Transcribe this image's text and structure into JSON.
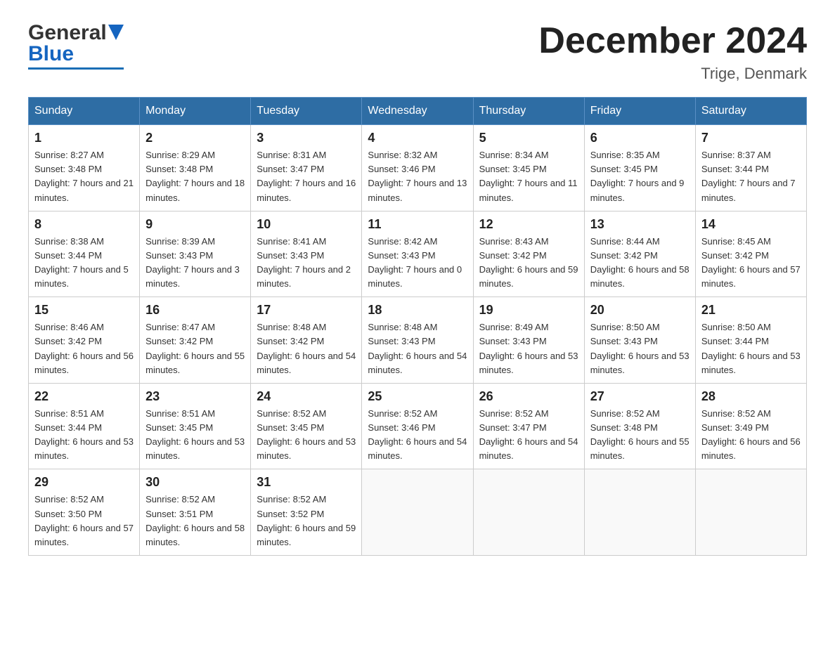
{
  "header": {
    "logo_general": "General",
    "logo_blue": "Blue",
    "month_title": "December 2024",
    "subtitle": "Trige, Denmark"
  },
  "days_of_week": [
    "Sunday",
    "Monday",
    "Tuesday",
    "Wednesday",
    "Thursday",
    "Friday",
    "Saturday"
  ],
  "weeks": [
    [
      {
        "day": "1",
        "sunrise": "8:27 AM",
        "sunset": "3:48 PM",
        "daylight": "7 hours and 21 minutes."
      },
      {
        "day": "2",
        "sunrise": "8:29 AM",
        "sunset": "3:48 PM",
        "daylight": "7 hours and 18 minutes."
      },
      {
        "day": "3",
        "sunrise": "8:31 AM",
        "sunset": "3:47 PM",
        "daylight": "7 hours and 16 minutes."
      },
      {
        "day": "4",
        "sunrise": "8:32 AM",
        "sunset": "3:46 PM",
        "daylight": "7 hours and 13 minutes."
      },
      {
        "day": "5",
        "sunrise": "8:34 AM",
        "sunset": "3:45 PM",
        "daylight": "7 hours and 11 minutes."
      },
      {
        "day": "6",
        "sunrise": "8:35 AM",
        "sunset": "3:45 PM",
        "daylight": "7 hours and 9 minutes."
      },
      {
        "day": "7",
        "sunrise": "8:37 AM",
        "sunset": "3:44 PM",
        "daylight": "7 hours and 7 minutes."
      }
    ],
    [
      {
        "day": "8",
        "sunrise": "8:38 AM",
        "sunset": "3:44 PM",
        "daylight": "7 hours and 5 minutes."
      },
      {
        "day": "9",
        "sunrise": "8:39 AM",
        "sunset": "3:43 PM",
        "daylight": "7 hours and 3 minutes."
      },
      {
        "day": "10",
        "sunrise": "8:41 AM",
        "sunset": "3:43 PM",
        "daylight": "7 hours and 2 minutes."
      },
      {
        "day": "11",
        "sunrise": "8:42 AM",
        "sunset": "3:43 PM",
        "daylight": "7 hours and 0 minutes."
      },
      {
        "day": "12",
        "sunrise": "8:43 AM",
        "sunset": "3:42 PM",
        "daylight": "6 hours and 59 minutes."
      },
      {
        "day": "13",
        "sunrise": "8:44 AM",
        "sunset": "3:42 PM",
        "daylight": "6 hours and 58 minutes."
      },
      {
        "day": "14",
        "sunrise": "8:45 AM",
        "sunset": "3:42 PM",
        "daylight": "6 hours and 57 minutes."
      }
    ],
    [
      {
        "day": "15",
        "sunrise": "8:46 AM",
        "sunset": "3:42 PM",
        "daylight": "6 hours and 56 minutes."
      },
      {
        "day": "16",
        "sunrise": "8:47 AM",
        "sunset": "3:42 PM",
        "daylight": "6 hours and 55 minutes."
      },
      {
        "day": "17",
        "sunrise": "8:48 AM",
        "sunset": "3:42 PM",
        "daylight": "6 hours and 54 minutes."
      },
      {
        "day": "18",
        "sunrise": "8:48 AM",
        "sunset": "3:43 PM",
        "daylight": "6 hours and 54 minutes."
      },
      {
        "day": "19",
        "sunrise": "8:49 AM",
        "sunset": "3:43 PM",
        "daylight": "6 hours and 53 minutes."
      },
      {
        "day": "20",
        "sunrise": "8:50 AM",
        "sunset": "3:43 PM",
        "daylight": "6 hours and 53 minutes."
      },
      {
        "day": "21",
        "sunrise": "8:50 AM",
        "sunset": "3:44 PM",
        "daylight": "6 hours and 53 minutes."
      }
    ],
    [
      {
        "day": "22",
        "sunrise": "8:51 AM",
        "sunset": "3:44 PM",
        "daylight": "6 hours and 53 minutes."
      },
      {
        "day": "23",
        "sunrise": "8:51 AM",
        "sunset": "3:45 PM",
        "daylight": "6 hours and 53 minutes."
      },
      {
        "day": "24",
        "sunrise": "8:52 AM",
        "sunset": "3:45 PM",
        "daylight": "6 hours and 53 minutes."
      },
      {
        "day": "25",
        "sunrise": "8:52 AM",
        "sunset": "3:46 PM",
        "daylight": "6 hours and 54 minutes."
      },
      {
        "day": "26",
        "sunrise": "8:52 AM",
        "sunset": "3:47 PM",
        "daylight": "6 hours and 54 minutes."
      },
      {
        "day": "27",
        "sunrise": "8:52 AM",
        "sunset": "3:48 PM",
        "daylight": "6 hours and 55 minutes."
      },
      {
        "day": "28",
        "sunrise": "8:52 AM",
        "sunset": "3:49 PM",
        "daylight": "6 hours and 56 minutes."
      }
    ],
    [
      {
        "day": "29",
        "sunrise": "8:52 AM",
        "sunset": "3:50 PM",
        "daylight": "6 hours and 57 minutes."
      },
      {
        "day": "30",
        "sunrise": "8:52 AM",
        "sunset": "3:51 PM",
        "daylight": "6 hours and 58 minutes."
      },
      {
        "day": "31",
        "sunrise": "8:52 AM",
        "sunset": "3:52 PM",
        "daylight": "6 hours and 59 minutes."
      },
      null,
      null,
      null,
      null
    ]
  ]
}
